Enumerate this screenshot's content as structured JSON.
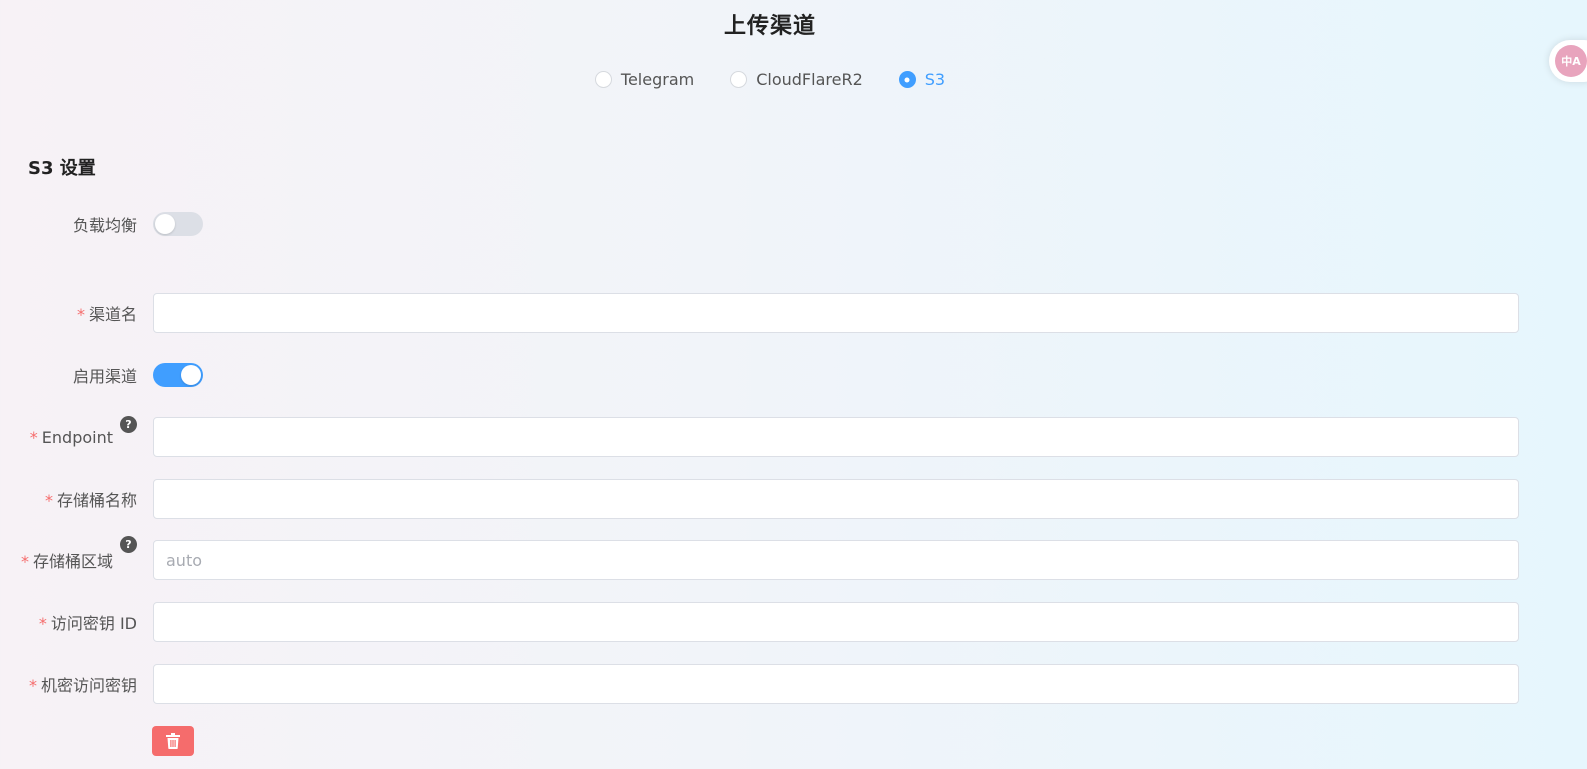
{
  "page_title": "上传渠道",
  "channel_options": [
    {
      "label": "Telegram",
      "checked": false
    },
    {
      "label": "CloudFlareR2",
      "checked": false
    },
    {
      "label": "S3",
      "checked": true
    }
  ],
  "section_title": "S3 设置",
  "translate_icon_text": "中A",
  "form": {
    "load_balance": {
      "label": "负载均衡",
      "on": false
    },
    "channel_name": {
      "label": "渠道名",
      "required": true,
      "value": ""
    },
    "enable_channel": {
      "label": "启用渠道",
      "on": true
    },
    "endpoint": {
      "label": "Endpoint",
      "required": true,
      "value": "",
      "help": "?"
    },
    "bucket_name": {
      "label": "存储桶名称",
      "required": true,
      "value": ""
    },
    "bucket_region": {
      "label": "存储桶区域",
      "required": true,
      "value": "",
      "placeholder": "auto",
      "help": "?"
    },
    "access_key_id": {
      "label": "访问密钥 ID",
      "required": true,
      "value": ""
    },
    "secret_access_key": {
      "label": "机密访问密钥",
      "required": true,
      "value": ""
    }
  },
  "required_mark": "*",
  "colors": {
    "accent": "#409eff",
    "danger": "#f56c6c",
    "required": "#f56c6c",
    "translate_badge": "#e8a4bd"
  },
  "icons": {
    "delete": "trash-icon",
    "help": "question-circle-icon",
    "translate": "translate-icon"
  }
}
